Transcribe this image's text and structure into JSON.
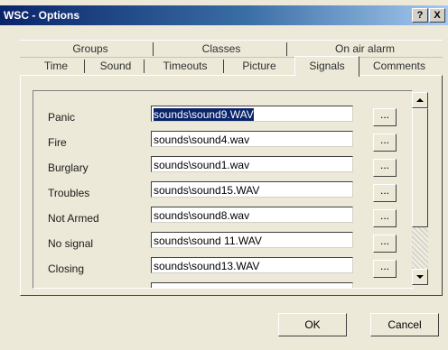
{
  "window": {
    "title": "WSC - Options",
    "help_label": "?",
    "close_label": "X"
  },
  "tabs": {
    "row1": [
      {
        "label": "Groups"
      },
      {
        "label": "Classes"
      },
      {
        "label": "On air alarm"
      }
    ],
    "row2": [
      {
        "label": "Time"
      },
      {
        "label": "Sound"
      },
      {
        "label": "Timeouts"
      },
      {
        "label": "Picture"
      },
      {
        "label": "Signals",
        "active": true
      },
      {
        "label": "Comments"
      }
    ]
  },
  "signals": {
    "rows": [
      {
        "label": "Panic",
        "value": "sounds\\sound9.WAV",
        "selected": true,
        "browse": "..."
      },
      {
        "label": "Fire",
        "value": "sounds\\sound4.wav",
        "browse": "..."
      },
      {
        "label": "Burglary",
        "value": "sounds\\sound1.wav",
        "browse": "..."
      },
      {
        "label": "Troubles",
        "value": "sounds\\sound15.WAV",
        "browse": "..."
      },
      {
        "label": "Not Armed",
        "value": "sounds\\sound8.wav",
        "browse": "..."
      },
      {
        "label": "No signal",
        "value": "sounds\\sound 11.WAV",
        "browse": "..."
      },
      {
        "label": "Closing",
        "value": "sounds\\sound13.WAV",
        "browse": "..."
      }
    ],
    "scrollbar": {
      "up_icon": "scroll-up-arrow",
      "down_icon": "scroll-down-arrow"
    }
  },
  "buttons": {
    "ok": "OK",
    "cancel": "Cancel"
  }
}
